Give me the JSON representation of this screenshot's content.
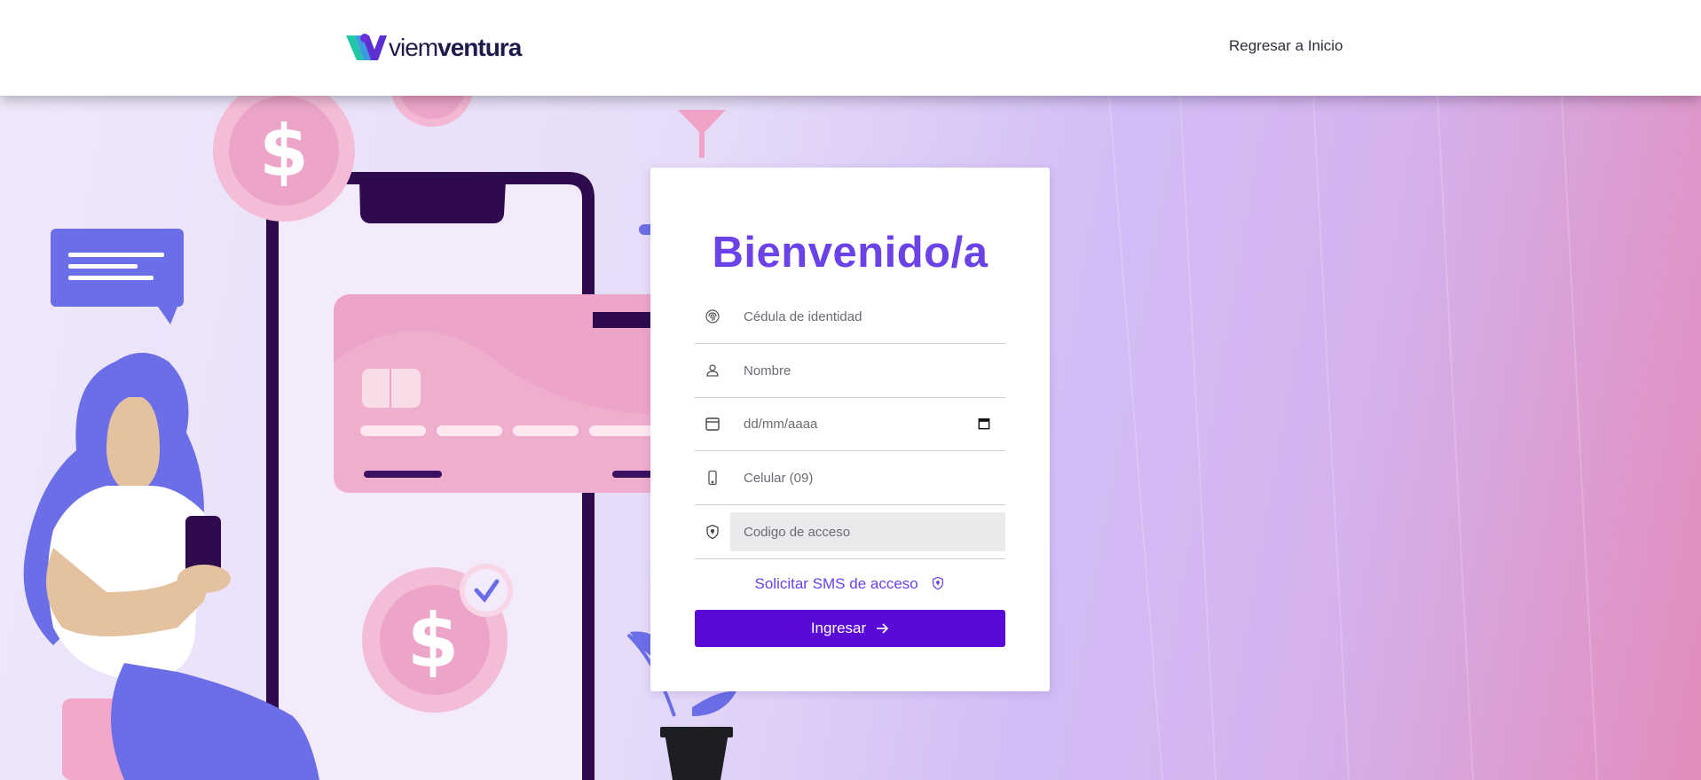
{
  "header": {
    "logo": {
      "light": "viem",
      "bold": "ventura"
    },
    "nav_link": "Regresar a Inicio"
  },
  "form": {
    "title": "Bienvenido/a",
    "fields": [
      {
        "name": "cedula",
        "icon": "fingerprint-icon",
        "placeholder": "Cédula de identidad",
        "value": ""
      },
      {
        "name": "nombre",
        "icon": "user-icon",
        "placeholder": "Nombre",
        "value": ""
      },
      {
        "name": "fecha",
        "icon": "calendar-icon",
        "placeholder": "dd/mm/aaaa",
        "value": ""
      },
      {
        "name": "celular",
        "icon": "mobile-icon",
        "placeholder": "Celular (09)",
        "value": ""
      },
      {
        "name": "codigo",
        "icon": "shield-icon",
        "placeholder": "Codigo de acceso",
        "value": ""
      }
    ],
    "sms_link": "Solicitar SMS de acceso",
    "submit_label": "Ingresar"
  },
  "colors": {
    "accent": "#6a42e8",
    "button": "#5a0ad6",
    "pink": "#eda4c9",
    "illus_purple": "#6b6ee6"
  }
}
